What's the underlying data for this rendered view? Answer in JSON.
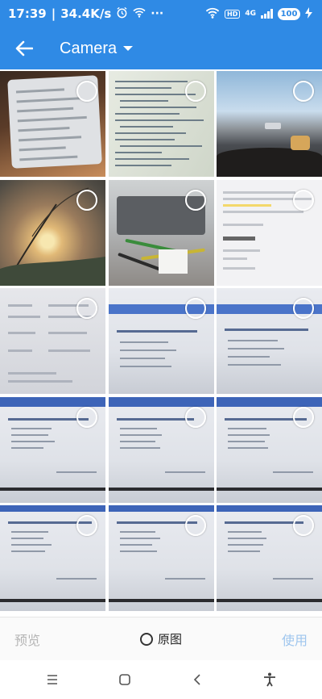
{
  "status_bar": {
    "time": "17:39",
    "net_speed": "34.4K/s",
    "battery": "100",
    "hd_label": "HD",
    "network_label": "4G"
  },
  "app_bar": {
    "title": "Camera",
    "back_icon": "arrow-left-icon",
    "dropdown_icon": "caret-down-icon"
  },
  "photos": [
    {
      "name": "photo-1",
      "kind": "device-screen",
      "selected": false
    },
    {
      "name": "photo-2",
      "kind": "code-screen",
      "selected": false
    },
    {
      "name": "photo-3",
      "kind": "road-view",
      "selected": false
    },
    {
      "name": "photo-4",
      "kind": "sunset-plant",
      "selected": false
    },
    {
      "name": "photo-5",
      "kind": "hardware-cables",
      "selected": false
    },
    {
      "name": "photo-6",
      "kind": "document-page",
      "selected": false
    },
    {
      "name": "photo-7",
      "kind": "form-document",
      "selected": false
    },
    {
      "name": "photo-8",
      "kind": "quiz-screen",
      "selected": false
    },
    {
      "name": "photo-9",
      "kind": "quiz-screen",
      "selected": false
    },
    {
      "name": "photo-10",
      "kind": "quiz-screen",
      "selected": false
    },
    {
      "name": "photo-11",
      "kind": "quiz-screen",
      "selected": false
    },
    {
      "name": "photo-12",
      "kind": "quiz-screen",
      "selected": false
    },
    {
      "name": "photo-13",
      "kind": "quiz-screen",
      "selected": false
    },
    {
      "name": "photo-14",
      "kind": "quiz-screen",
      "selected": false
    },
    {
      "name": "photo-15",
      "kind": "quiz-screen",
      "selected": false
    }
  ],
  "bottom_bar": {
    "preview_label": "预览",
    "original_label": "原图",
    "use_label": "使用"
  },
  "colors": {
    "primary": "#2f8ae5",
    "disabled_text": "#b5b5b5",
    "use_disabled": "#9fc6ee"
  }
}
